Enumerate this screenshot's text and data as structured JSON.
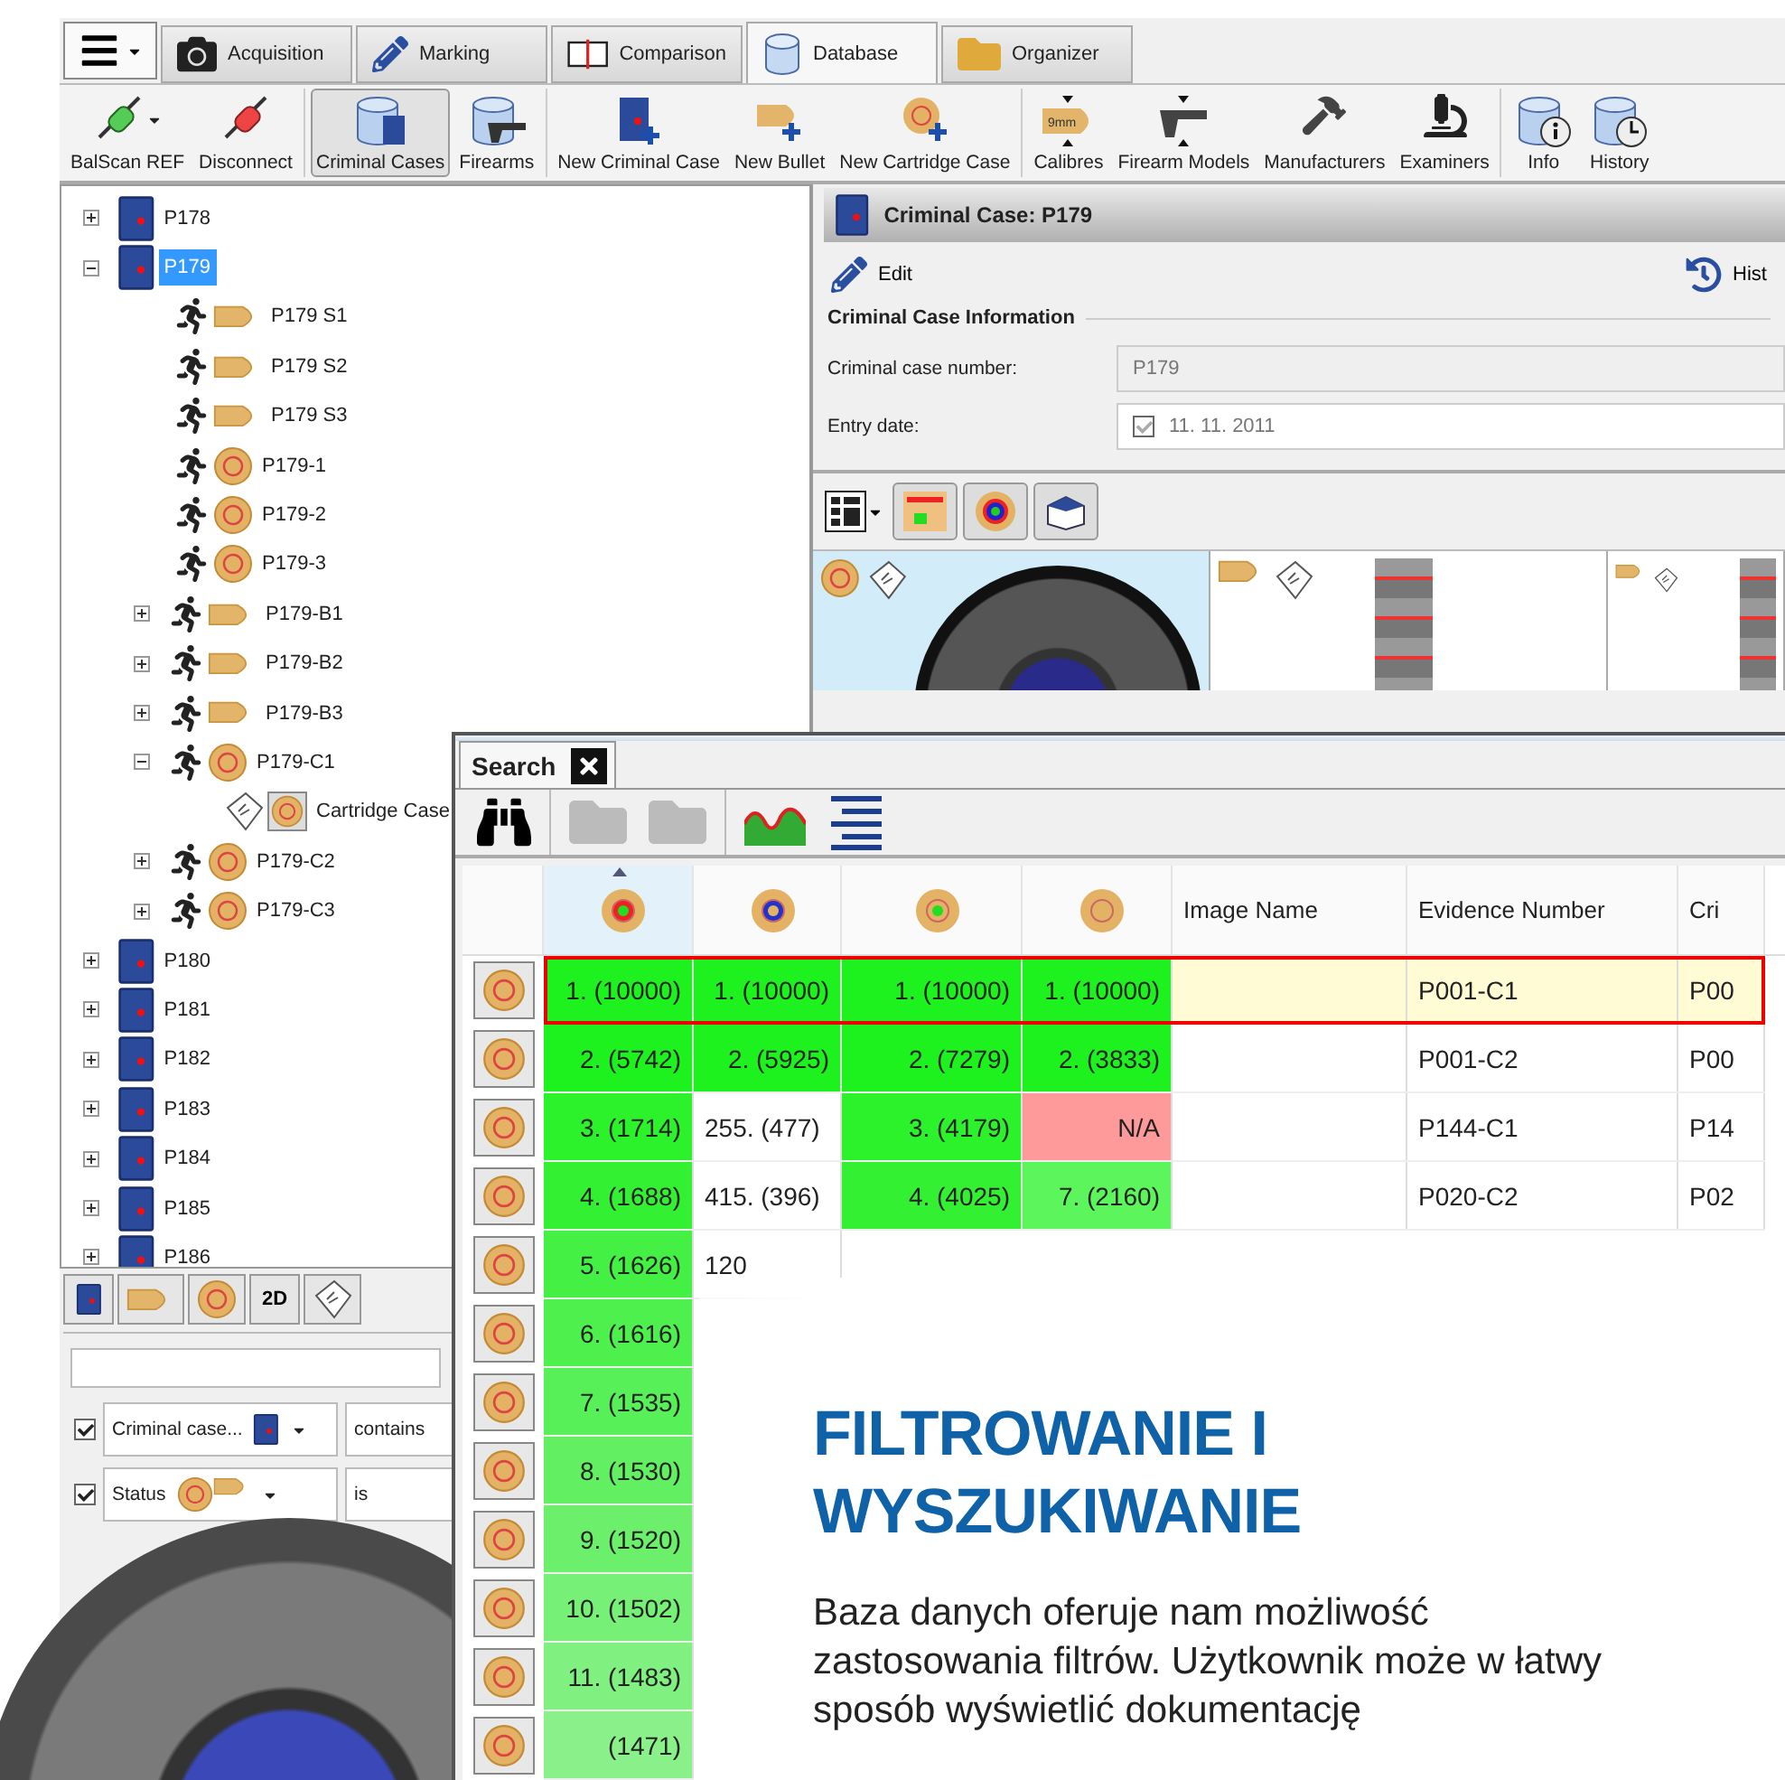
{
  "tabs": [
    {
      "label": "Acquisition",
      "kind": "camera",
      "selected": false
    },
    {
      "label": "Marking",
      "kind": "pencil",
      "selected": false
    },
    {
      "label": "Comparison",
      "kind": "compare",
      "selected": false
    },
    {
      "label": "Database",
      "kind": "database",
      "selected": true
    },
    {
      "label": "Organizer",
      "kind": "folder",
      "selected": false
    }
  ],
  "ribbon": [
    [
      {
        "label": "BalScan REF",
        "kind": "connect",
        "dropdown": true,
        "pressed": false
      },
      {
        "label": "Disconnect",
        "kind": "disconnect",
        "dropdown": false,
        "pressed": false
      }
    ],
    [
      {
        "label": "Criminal Cases",
        "kind": "cases",
        "dropdown": false,
        "pressed": true
      },
      {
        "label": "Firearms",
        "kind": "firearms",
        "dropdown": false,
        "pressed": false
      }
    ],
    [
      {
        "label": "New Criminal Case",
        "kind": "newcase",
        "dropdown": false,
        "pressed": false
      },
      {
        "label": "New Bullet",
        "kind": "newbullet",
        "dropdown": false,
        "pressed": false
      },
      {
        "label": "New Cartridge Case",
        "kind": "newcartridge",
        "dropdown": false,
        "pressed": false
      }
    ],
    [
      {
        "label": "Calibres",
        "kind": "calibre",
        "badge": "9mm",
        "dropdown": false,
        "pressed": false
      },
      {
        "label": "Firearm Models",
        "kind": "models",
        "dropdown": false,
        "pressed": false
      },
      {
        "label": "Manufacturers",
        "kind": "manufacturers",
        "dropdown": false,
        "pressed": false
      },
      {
        "label": "Examiners",
        "kind": "examiners",
        "dropdown": false,
        "pressed": false
      }
    ],
    [
      {
        "label": "Info",
        "kind": "info",
        "dropdown": false,
        "pressed": false
      },
      {
        "label": "History",
        "kind": "history",
        "dropdown": false,
        "pressed": false
      }
    ]
  ],
  "tree": [
    {
      "label": "P178",
      "kind": "case",
      "expanded": false,
      "selected": false
    },
    {
      "label": "P179",
      "kind": "case",
      "expanded": true,
      "selected": true,
      "children": [
        {
          "label": "P179 S1",
          "kind": "bullet",
          "selected": false
        },
        {
          "label": "P179 S2",
          "kind": "bullet",
          "selected": false
        },
        {
          "label": "P179 S3",
          "kind": "bullet",
          "selected": false
        },
        {
          "label": "P179-1",
          "kind": "cartridge",
          "selected": false
        },
        {
          "label": "P179-2",
          "kind": "cartridge",
          "selected": false
        },
        {
          "label": "P179-3",
          "kind": "cartridge",
          "selected": false
        },
        {
          "label": "P179-B1",
          "kind": "bullet",
          "expanded": false,
          "selected": false
        },
        {
          "label": "P179-B2",
          "kind": "bullet",
          "expanded": false,
          "selected": false
        },
        {
          "label": "P179-B3",
          "kind": "bullet",
          "expanded": false,
          "selected": false
        },
        {
          "label": "P179-C1",
          "kind": "cartridge",
          "expanded": true,
          "selected": false,
          "children": [
            {
              "label": "Cartridge Case",
              "kind": "scan",
              "selected": false
            }
          ]
        },
        {
          "label": "P179-C2",
          "kind": "cartridge",
          "expanded": false,
          "selected": false
        },
        {
          "label": "P179-C3",
          "kind": "cartridge",
          "expanded": false,
          "selected": false
        }
      ]
    },
    {
      "label": "P180",
      "kind": "case",
      "expanded": false,
      "selected": false
    },
    {
      "label": "P181",
      "kind": "case",
      "expanded": false,
      "selected": false
    },
    {
      "label": "P182",
      "kind": "case",
      "expanded": false,
      "selected": false
    },
    {
      "label": "P183",
      "kind": "case",
      "expanded": false,
      "selected": false
    },
    {
      "label": "P184",
      "kind": "case",
      "expanded": false,
      "selected": false
    },
    {
      "label": "P185",
      "kind": "case",
      "expanded": false,
      "selected": false
    },
    {
      "label": "P186",
      "kind": "case",
      "expanded": false,
      "selected": false
    }
  ],
  "filter_panel": {
    "view_buttons": [
      {
        "kind": "case"
      },
      {
        "kind": "bullet"
      },
      {
        "kind": "cartridge"
      },
      {
        "kind": "text",
        "label": "2D"
      },
      {
        "kind": "scan"
      }
    ],
    "filters": [
      {
        "checked": true,
        "field": "Criminal case...",
        "kind": "case",
        "operator": "contains"
      },
      {
        "checked": true,
        "field": "Status",
        "kind": "ammo",
        "operator": "is"
      }
    ]
  },
  "detail": {
    "title": "Criminal Case: P179",
    "edit": "Edit",
    "history": "Hist",
    "section": "Criminal Case Information",
    "fields": [
      {
        "label": "Criminal case number:",
        "value": "P179",
        "checkbox": false,
        "disabled": true
      },
      {
        "label": "Entry date:",
        "value": "11. 11. 2011",
        "checkbox": true,
        "disabled": false
      }
    ],
    "thumbnails": [
      {
        "kind": "cartridge",
        "selected": true
      },
      {
        "kind": "bullet",
        "selected": false
      },
      {
        "kind": "bullet",
        "selected": false
      }
    ]
  },
  "search": {
    "tab": "Search",
    "columns": [
      {
        "kind": "icon",
        "sorted": true
      },
      {
        "kind": "icon",
        "sorted": false
      },
      {
        "kind": "icon",
        "sorted": false
      },
      {
        "kind": "icon",
        "sorted": false
      },
      {
        "kind": "text",
        "label": "Image Name",
        "sorted": false
      },
      {
        "kind": "text",
        "label": "Evidence Number",
        "sorted": false
      },
      {
        "kind": "text",
        "label": "Cri",
        "sorted": false
      }
    ],
    "rows": [
      {
        "selected": true,
        "cells": [
          {
            "text": "1. (10000)",
            "color": "#1ef21e"
          },
          {
            "text": "1. (10000)",
            "color": "#1ef21e"
          },
          {
            "text": "1. (10000)",
            "color": "#1ef21e"
          },
          {
            "text": "1. (10000)",
            "color": "#1ef21e"
          },
          {},
          {
            "text": "P001-C1"
          },
          {
            "text": "P00"
          }
        ]
      },
      {
        "selected": false,
        "cells": [
          {
            "text": "2. (5742)",
            "color": "#1ef21e"
          },
          {
            "text": "2. (5925)",
            "color": "#1ef21e"
          },
          {
            "text": "2. (7279)",
            "color": "#1ef21e"
          },
          {
            "text": "2. (3833)",
            "color": "#1ef21e"
          },
          {},
          {
            "text": "P001-C2"
          },
          {
            "text": "P00"
          }
        ]
      },
      {
        "selected": false,
        "cells": [
          {
            "text": "3. (1714)",
            "color": "#2bf22b"
          },
          {
            "text": "255. (477)"
          },
          {
            "text": "3. (4179)",
            "color": "#2bf22b"
          },
          {
            "text": "N/A",
            "color": "#ff9a9a"
          },
          {},
          {
            "text": "P144-C1"
          },
          {
            "text": "P14"
          }
        ]
      },
      {
        "selected": false,
        "cells": [
          {
            "text": "4. (1688)",
            "color": "#33f033"
          },
          {
            "text": "415. (396)"
          },
          {
            "text": "4. (4025)",
            "color": "#33f033"
          },
          {
            "text": "7. (2160)",
            "color": "#5cf55c"
          },
          {},
          {
            "text": "P020-C2"
          },
          {
            "text": "P02"
          }
        ]
      },
      {
        "selected": false,
        "cells": [
          {
            "text": "5. (1626)",
            "color": "#44f044"
          },
          {
            "text": "120"
          }
        ]
      },
      {
        "selected": false,
        "cells": [
          {
            "text": "6. (1616)",
            "color": "#4ef04e"
          }
        ]
      },
      {
        "selected": false,
        "cells": [
          {
            "text": "7. (1535)",
            "color": "#58f058"
          }
        ]
      },
      {
        "selected": false,
        "cells": [
          {
            "text": "8. (1530)",
            "color": "#62f062"
          }
        ]
      },
      {
        "selected": false,
        "cells": [
          {
            "text": "9. (1520)",
            "color": "#6cf06c"
          }
        ]
      },
      {
        "selected": false,
        "cells": [
          {
            "text": "10. (1502)",
            "color": "#76f076"
          }
        ]
      },
      {
        "selected": false,
        "cells": [
          {
            "text": "11. (1483)",
            "color": "#80f080"
          }
        ]
      },
      {
        "selected": false,
        "cells": [
          {
            "text": "(1471)",
            "color": "#8af08a"
          }
        ]
      }
    ]
  },
  "promo": {
    "heading": [
      "FILTROWANIE I",
      "WYSZUKIWANIE"
    ],
    "body": "Baza danych oferuje nam możliwość zastosowania filtrów. Użytkownik może w łatwy sposób wyświetlić dokumentację"
  }
}
